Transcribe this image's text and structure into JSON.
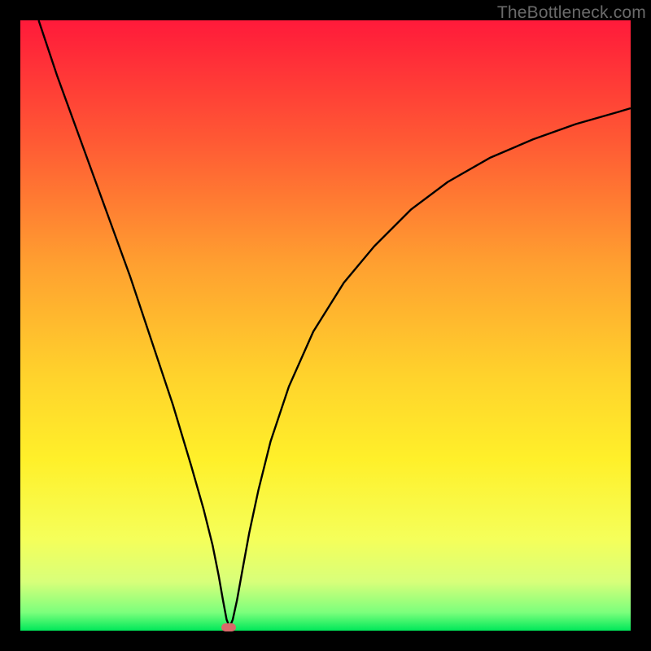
{
  "attribution": "TheBottleneck.com",
  "chart_data": {
    "type": "line",
    "title": "",
    "xlabel": "",
    "ylabel": "",
    "xlim": [
      0,
      100
    ],
    "ylim": [
      0,
      100
    ],
    "grid": false,
    "legend": false,
    "gradient_stops": [
      {
        "offset": 0,
        "color": "#ff1a3a"
      },
      {
        "offset": 0.2,
        "color": "#ff5a34"
      },
      {
        "offset": 0.4,
        "color": "#ffa030"
      },
      {
        "offset": 0.58,
        "color": "#ffd22c"
      },
      {
        "offset": 0.72,
        "color": "#fff02a"
      },
      {
        "offset": 0.85,
        "color": "#f5ff5a"
      },
      {
        "offset": 0.92,
        "color": "#d8ff7a"
      },
      {
        "offset": 0.97,
        "color": "#7cff7c"
      },
      {
        "offset": 1.0,
        "color": "#00e85a"
      }
    ],
    "series": [
      {
        "name": "bottleneck-curve",
        "color": "#000000",
        "x": [
          3,
          6,
          10,
          14,
          18,
          22,
          25,
          28,
          30,
          31.5,
          32.5,
          33.2,
          33.8,
          34.3,
          34.8,
          35.5,
          36.4,
          37.5,
          39,
          41,
          44,
          48,
          53,
          58,
          64,
          70,
          77,
          84,
          91,
          98,
          100
        ],
        "y": [
          100,
          91,
          80,
          69,
          58,
          46,
          37,
          27,
          20,
          14,
          9,
          5,
          1.8,
          0.6,
          1.8,
          5,
          10,
          16,
          23,
          31,
          40,
          49,
          57,
          63,
          69,
          73.5,
          77.5,
          80.5,
          83,
          85,
          85.6
        ]
      }
    ],
    "marker": {
      "x": 34.1,
      "y": 0.6,
      "color": "#d96a6a"
    }
  }
}
